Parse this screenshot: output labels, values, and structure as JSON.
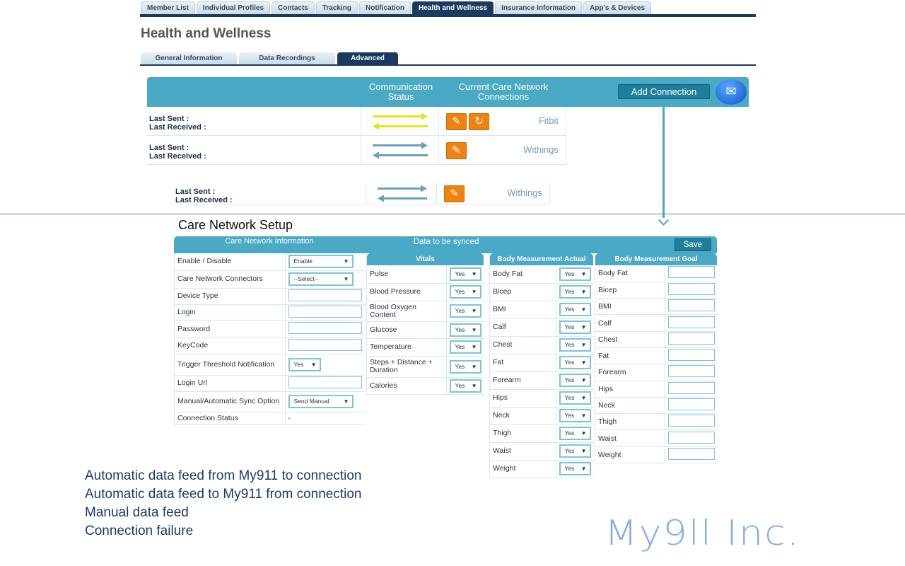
{
  "top_tabs": [
    "Member List",
    "Individual Profiles",
    "Contacts",
    "Tracking",
    "Notification",
    "Health and Wellness",
    "Insurance Information",
    "App's & Devices"
  ],
  "active_top_tab": "Health and Wellness",
  "page_title": "Health and Wellness",
  "sub_tabs": [
    "General Information",
    "Data Recordings",
    "Advanced"
  ],
  "active_sub_tab": "Advanced",
  "connections": {
    "header": {
      "comm_status": "Communication Status",
      "current": "Current Care Network Connections",
      "add_button": "Add Connection",
      "mail_icon": "envelope-icon"
    },
    "last_sent": "Last Sent :",
    "last_received": "Last Received :",
    "rows": [
      {
        "device": "Fitbit",
        "arrow_color": "#e3e619",
        "icons": [
          "pencil-icon",
          "refresh-icon"
        ]
      },
      {
        "device": "Withings",
        "arrow_color": "#6a9fbf",
        "icons": [
          "pencil-icon"
        ]
      },
      {
        "device": "Withings",
        "arrow_color": "#6a9fbf",
        "icons": [
          "pencil-icon"
        ]
      }
    ]
  },
  "setup": {
    "title": "Care Network Setup",
    "info_header": "Care Network Information",
    "sync_header": "Data to be synced",
    "save": "Save",
    "info_rows": [
      {
        "label": "Enable / Disable",
        "type": "select",
        "value": "Enable"
      },
      {
        "label": "Care Network Connectors",
        "type": "select",
        "value": "--Select--"
      },
      {
        "label": "Device Type",
        "type": "input",
        "value": ""
      },
      {
        "label": "Login",
        "type": "input",
        "value": ""
      },
      {
        "label": "Password",
        "type": "input",
        "value": ""
      },
      {
        "label": "KeyCode",
        "type": "input",
        "value": ""
      },
      {
        "label": "Trigger Threshold Notification",
        "type": "select-small",
        "value": "Yes"
      },
      {
        "label": "Login Url",
        "type": "input",
        "value": ""
      },
      {
        "label": "Manual/Automatic Sync Option",
        "type": "select",
        "value": "Send Manual"
      },
      {
        "label": "Connection Status",
        "type": "text",
        "value": "-"
      }
    ],
    "vitals": {
      "header": "Vitals",
      "rows": [
        "Pulse",
        "Blood Pressure",
        "Blood Oxygen Content",
        "Glucose",
        "Temperature",
        "Steps + Distance + Duration",
        "Calories"
      ],
      "value": "Yes"
    },
    "actual": {
      "header": "Body Measurement Actual",
      "rows": [
        "Body Fat",
        "Bicep",
        "BMI",
        "Calf",
        "Chest",
        "Fat",
        "Forearm",
        "Hips",
        "Neck",
        "Thigh",
        "Waist",
        "Weight"
      ],
      "value": "Yes"
    },
    "goal": {
      "header": "Body Measurement Goal",
      "rows": [
        "Body Fat",
        "Bicep",
        "BMI",
        "Calf",
        "Chest",
        "Fat",
        "Forearm",
        "Hips",
        "Neck",
        "Thigh",
        "Waist",
        "Weight"
      ]
    }
  },
  "legend": [
    {
      "text": "Automatic data feed from My911 to connection",
      "style": "arrow-right",
      "color": "#4f81bd"
    },
    {
      "text": "Automatic data feed to My911 from connection",
      "style": "arrow-left",
      "color": "#4f81bd"
    },
    {
      "text": "Manual data feed",
      "style": "dashed",
      "color": "#ffc000"
    },
    {
      "text": "Connection failure",
      "style": "solid",
      "color": "#e00000"
    }
  ],
  "logo": "My9ll Inc."
}
